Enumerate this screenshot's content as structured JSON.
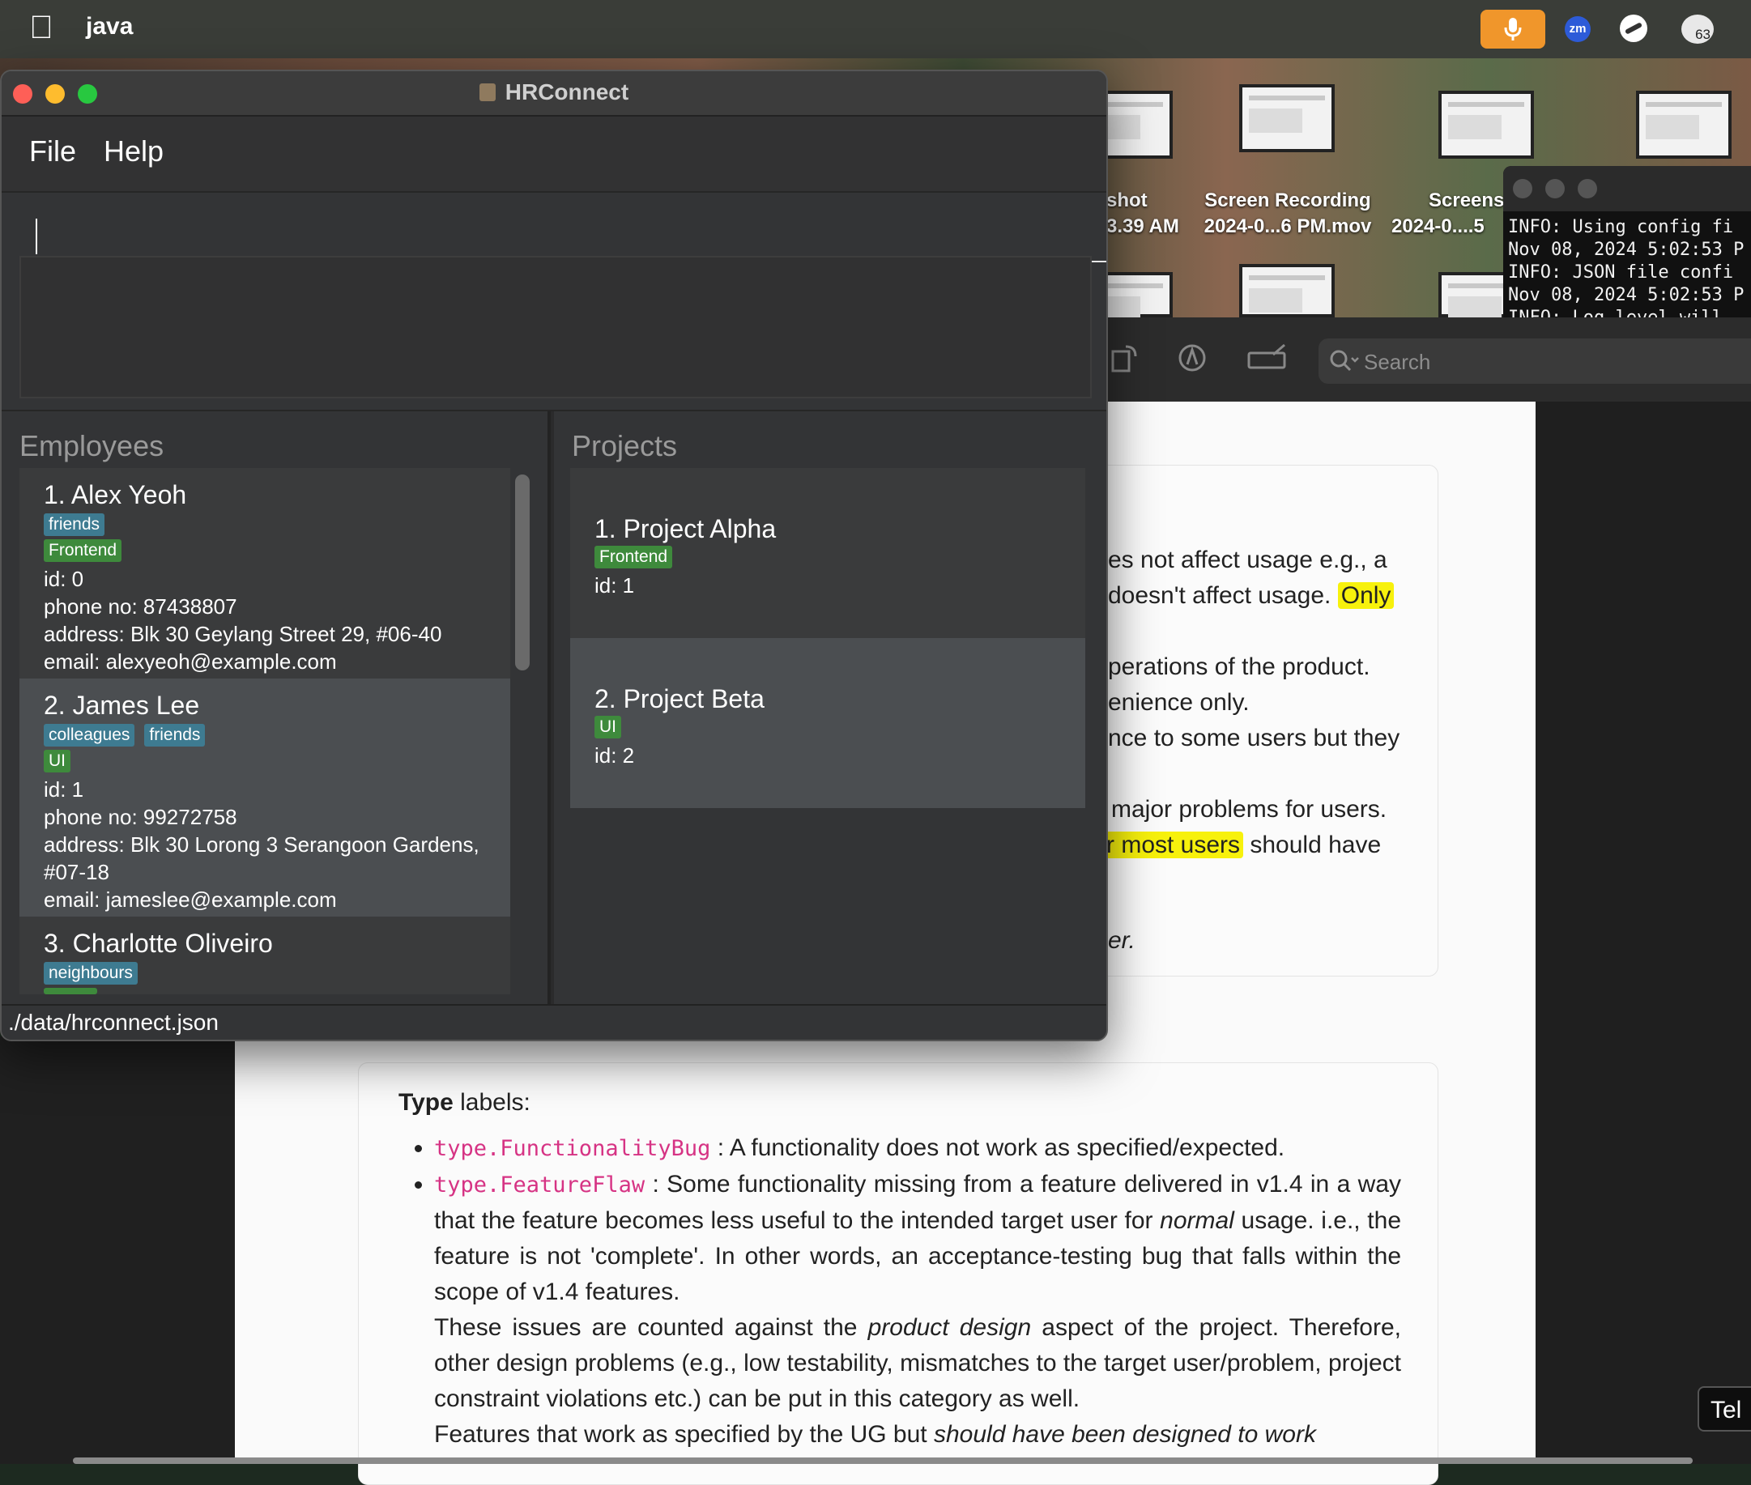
{
  "menubar": {
    "app_name": "java",
    "notification_count": "63",
    "zoom_label": "zm"
  },
  "desktop": {
    "items": [
      {
        "line1": "shot",
        "line2": "3.39 AM"
      },
      {
        "line1": "Screen Recording",
        "line2": "2024-0...6 PM.mov"
      },
      {
        "line1": "Screens",
        "line2": "2024-0....5"
      }
    ]
  },
  "terminal": {
    "lines": [
      "INFO: Using config fi",
      "Nov 08, 2024 5:02:53 P",
      "INFO: JSON file confi",
      "Nov 08, 2024 5:02:53 P",
      "INFO: Log level will"
    ]
  },
  "preview": {
    "search_placeholder": "Search",
    "tel_label": "Tel",
    "snippets": [
      "es not affect usage e.g., a",
      "doesn't affect usage.",
      "Only",
      "perations of the product.",
      "enience only.",
      "nce to some users but they",
      "major problems for users.",
      "r most users",
      "should have",
      "er."
    ],
    "type_labels": {
      "heading_bold": "Type",
      "heading_rest": " labels:",
      "items": [
        {
          "code": "type.FunctionalityBug",
          "text": " : A functionality does not work as specified/expected."
        },
        {
          "code": "type.FeatureFlaw",
          "text_parts": [
            " : Some functionality missing from a feature delivered in v1.4 in a way that the feature becomes less useful to the intended target user for ",
            "normal",
            " usage. i.e., the feature is not 'complete'. In other words, an acceptance-testing bug that falls within the scope of v1.4 features.",
            "These issues are counted against the ",
            "product design",
            " aspect of the project. Therefore, other design problems (e.g., low testability, mismatches to the target user/problem, project constraint violations etc.) can be put in this category as well.",
            "Features that work as specified by the UG but ",
            "should have been designed to work"
          ]
        }
      ]
    }
  },
  "app": {
    "title": "HRConnect",
    "menu": {
      "file": "File",
      "help": "Help"
    },
    "command_value": "",
    "result_text": "",
    "employees_title": "Employees",
    "projects_title": "Projects",
    "employees": [
      {
        "name": "1. Alex Yeoh",
        "tags": [
          "friends"
        ],
        "skills": [
          "Frontend"
        ],
        "id": "id: 0",
        "phone": "phone no: 87438807",
        "address": "address: Blk 30 Geylang Street 29, #06-40",
        "address2": "",
        "email": "email: alexyeoh@example.com"
      },
      {
        "name": "2. James Lee",
        "tags": [
          "colleagues",
          "friends"
        ],
        "skills": [
          "UI"
        ],
        "id": "id: 1",
        "phone": "phone no: 99272758",
        "address": "address: Blk 30 Lorong 3 Serangoon Gardens,",
        "address2": "#07-18",
        "email": "email: jameslee@example.com"
      },
      {
        "name": "3. Charlotte Oliveiro",
        "tags": [
          "neighbours"
        ],
        "skills": [],
        "id": "",
        "phone": "",
        "address": "",
        "address2": "",
        "email": ""
      }
    ],
    "projects": [
      {
        "name": "1. Project Alpha",
        "skill": "Frontend",
        "id": "id: 1"
      },
      {
        "name": "2. Project Beta",
        "skill": "UI",
        "id": "id: 2"
      }
    ],
    "status_path": "./data/hrconnect.json"
  },
  "colors": {
    "tag_blue": "#3e7b91",
    "tag_green": "#3e8a3c",
    "highlight": "#f7f10c",
    "code_pink": "#d63384",
    "mic_orange": "#f0962b"
  }
}
